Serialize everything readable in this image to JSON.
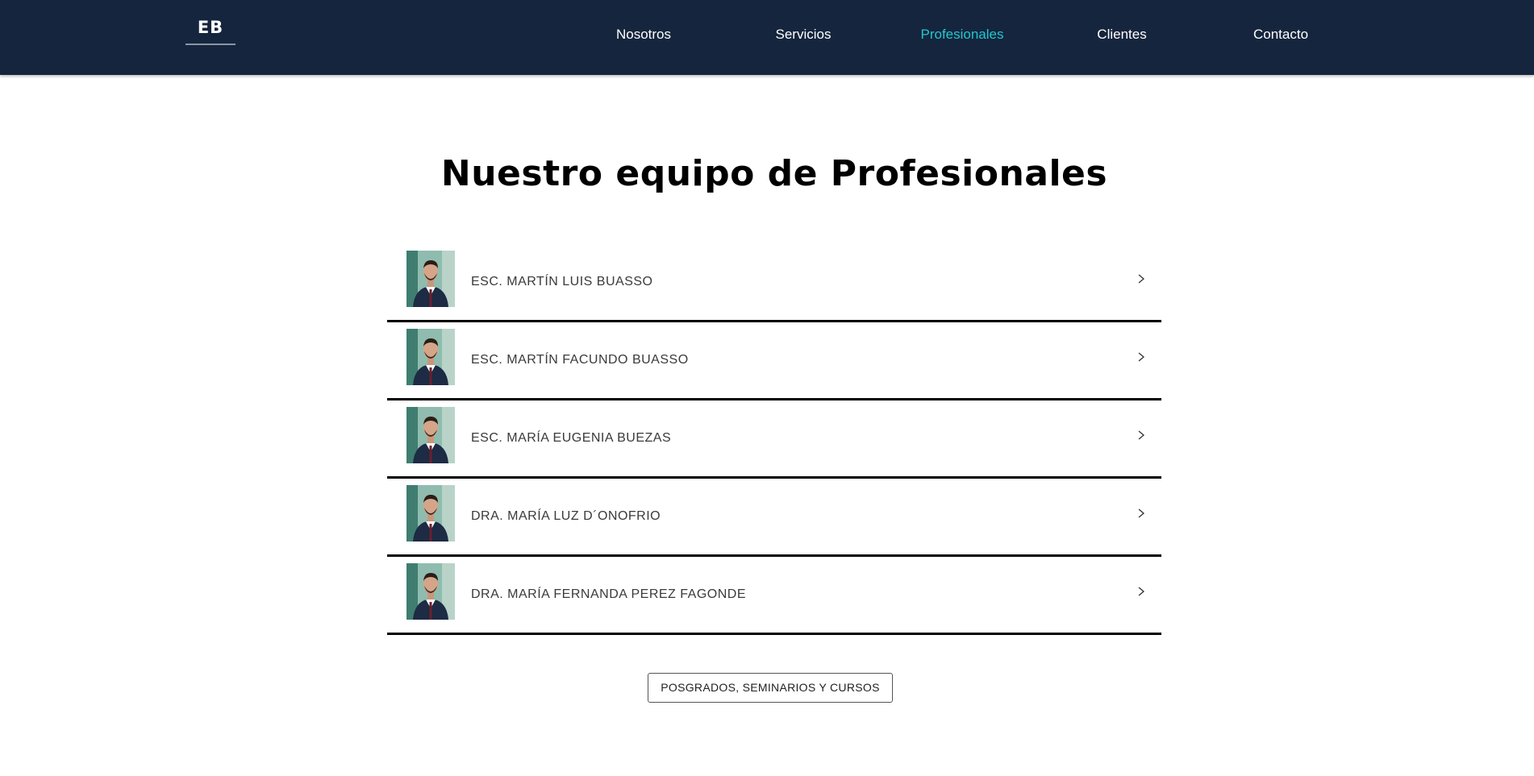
{
  "nav": {
    "logo": "EB",
    "items": [
      {
        "label": "Nosotros",
        "active": false
      },
      {
        "label": "Servicios",
        "active": false
      },
      {
        "label": "Profesionales",
        "active": true
      },
      {
        "label": "Clientes",
        "active": false
      },
      {
        "label": "Contacto",
        "active": false
      }
    ],
    "active_color": "#21c6cf",
    "background_color": "#15253d"
  },
  "main": {
    "title": "Nuestro equipo de Profesionales",
    "professionals": [
      {
        "name": "ESC. MARTÍN LUIS BUASSO",
        "icon": "chevron-right-icon"
      },
      {
        "name": "ESC. MARTÍN FACUNDO BUASSO",
        "icon": "chevron-right-icon"
      },
      {
        "name": "ESC. MARÍA EUGENIA BUEZAS",
        "icon": "chevron-right-icon"
      },
      {
        "name": "DRA. MARÍA LUZ D´ONOFRIO",
        "icon": "chevron-right-icon"
      },
      {
        "name": "DRA. MARÍA FERNANDA PEREZ FAGONDE",
        "icon": "chevron-right-icon"
      }
    ],
    "cta_label": "POSGRADOS, SEMINARIOS Y CURSOS"
  }
}
